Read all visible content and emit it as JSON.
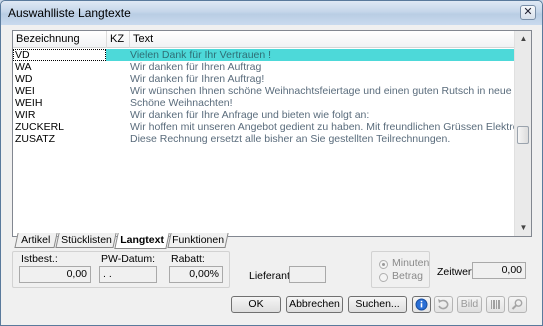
{
  "window": {
    "title": "Auswahlliste Langtexte",
    "close_label": "✕"
  },
  "list": {
    "columns": [
      "Bezeichnung",
      "KZ",
      "Text"
    ],
    "rows": [
      {
        "bez": "VD",
        "kz": "",
        "text": "Vielen Dank für Ihr Vertrauen !",
        "selected": true
      },
      {
        "bez": "WA",
        "kz": "",
        "text": "Wir danken für Ihren Auftrag"
      },
      {
        "bez": "WD",
        "kz": "",
        "text": "Wir danken für Ihren Auftrag!"
      },
      {
        "bez": "WEI",
        "kz": "",
        "text": "Wir wünschen Ihnen schöne Weihnachtsfeiertage und einen guten Rutsch in neue Jahr !!!"
      },
      {
        "bez": "WEIH",
        "kz": "",
        "text": "Schöne Weihnachten!"
      },
      {
        "bez": "WIR",
        "kz": "",
        "text": "Wir danken für Ihre Anfrage und bieten wie folgt an:"
      },
      {
        "bez": "ZUCKERL",
        "kz": "",
        "text": "Wir hoffen mit unseren Angebot gedient zu haben.  Mit freundlichen Grüssen Elektrotechnik mit Garar"
      },
      {
        "bez": "ZUSATZ",
        "kz": "",
        "text": "Diese Rechnung ersetzt alle bisher an Sie gestellten Teilrechnungen."
      }
    ]
  },
  "tabs": [
    {
      "label": "Artikel",
      "active": false
    },
    {
      "label": "Stücklisten",
      "active": false
    },
    {
      "label": "Langtext",
      "active": true
    },
    {
      "label": "Funktionen",
      "active": false
    }
  ],
  "info": {
    "istbest_label": "Istbest.:",
    "istbest_value": "0,00",
    "pwdatum_label": "PW-Datum:",
    "pwdatum_value": ". .",
    "rabatt_label": "Rabatt:",
    "rabatt_value": "0,00%",
    "lieferant_label": "Lieferant:",
    "lieferant_value": "",
    "radio_minuten": "Minuten",
    "radio_betrag": "Betrag",
    "zeitwert_label": "Zeitwert:",
    "zeitwert_value": "0,00"
  },
  "buttons": {
    "ok": "OK",
    "abbrechen": "Abbrechen",
    "suchen": "Suchen...",
    "bild": "Bild"
  },
  "icons": {
    "info": "info-icon",
    "refresh": "refresh-icon",
    "barcode": "barcode-icon",
    "search": "magnifier-icon"
  }
}
